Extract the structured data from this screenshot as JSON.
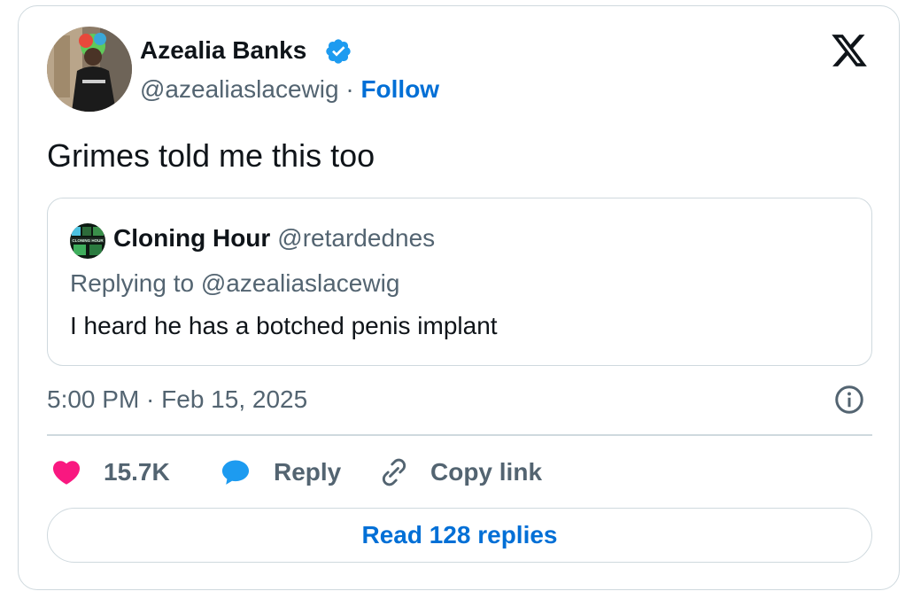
{
  "author": {
    "name": "Azealia Banks",
    "handle": "@azealiaslacewig",
    "separator": "·",
    "follow_label": "Follow"
  },
  "tweet": {
    "text": "Grimes told me this too",
    "timestamp": "5:00 PM · Feb 15, 2025"
  },
  "quote": {
    "name": "Cloning Hour",
    "handle": "@retardednes",
    "replying_to": "Replying to @azealiaslacewig",
    "text": "I heard he has a botched penis implant",
    "avatar_caption": "CLONING HOUR"
  },
  "actions": {
    "likes": "15.7K",
    "reply_label": "Reply",
    "copy_link_label": "Copy link"
  },
  "read_replies_label": "Read 128 replies",
  "icons": {
    "verified": "verified-badge-icon",
    "logo": "x-logo-icon",
    "info": "info-icon",
    "like": "heart-icon",
    "reply": "reply-bubble-icon",
    "copy": "link-icon"
  },
  "colors": {
    "accent": "#006fd6",
    "verified": "#1d9bf0",
    "heart": "#f91880",
    "reply_bubble": "#1d9bf0",
    "text_primary": "#0f1419",
    "text_secondary": "#536471",
    "border": "#cfd9de"
  }
}
